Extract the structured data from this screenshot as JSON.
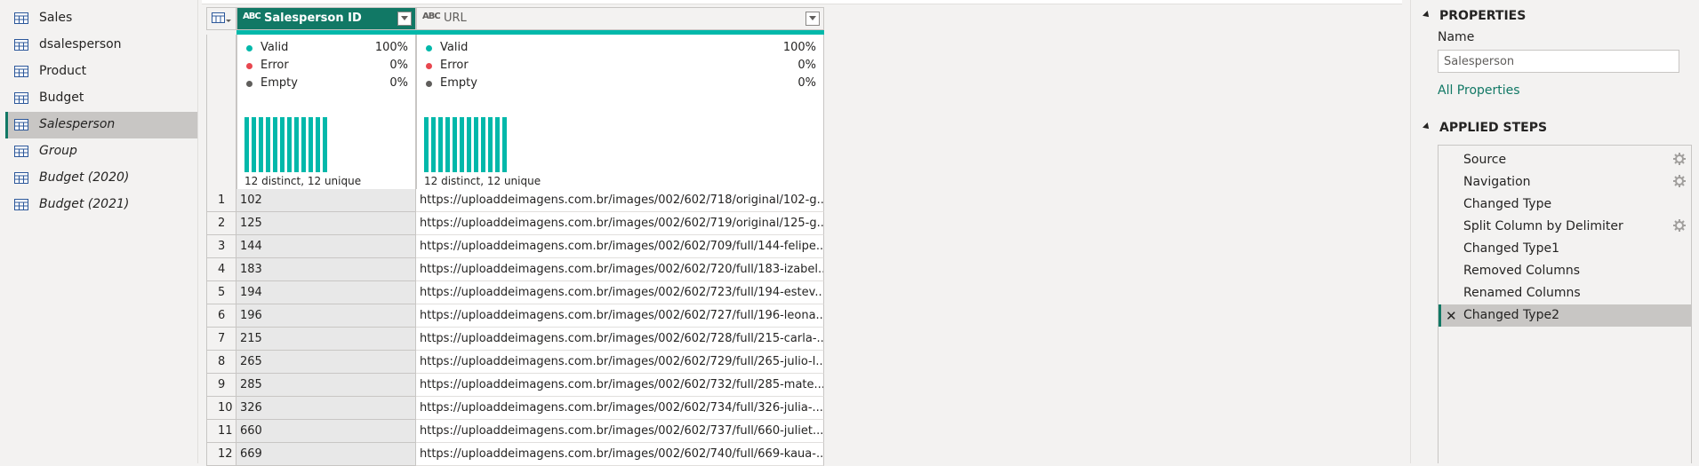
{
  "queries": [
    {
      "label": "Sales",
      "italic": false,
      "selected": false
    },
    {
      "label": "dsalesperson",
      "italic": false,
      "selected": false
    },
    {
      "label": "Product",
      "italic": false,
      "selected": false
    },
    {
      "label": "Budget",
      "italic": false,
      "selected": false
    },
    {
      "label": "Salesperson",
      "italic": true,
      "selected": true
    },
    {
      "label": "Group",
      "italic": true,
      "selected": false
    },
    {
      "label": "Budget (2020)",
      "italic": true,
      "selected": false
    },
    {
      "label": "Budget (2021)",
      "italic": true,
      "selected": false
    }
  ],
  "grid": {
    "type_badge": "ABC",
    "columns": [
      {
        "name": "Salesperson ID",
        "valid_label": "Valid",
        "valid_pct": "100%",
        "error_label": "Error",
        "error_pct": "0%",
        "empty_label": "Empty",
        "empty_pct": "0%",
        "distinct": "12 distinct, 12 unique"
      },
      {
        "name": "URL",
        "valid_label": "Valid",
        "valid_pct": "100%",
        "error_label": "Error",
        "error_pct": "0%",
        "empty_label": "Empty",
        "empty_pct": "0%",
        "distinct": "12 distinct, 12 unique"
      }
    ],
    "rows": [
      {
        "n": "1",
        "id": "102",
        "url": "https://uploaddeimagens.com.br/images/002/602/718/original/102-g..."
      },
      {
        "n": "2",
        "id": "125",
        "url": "https://uploaddeimagens.com.br/images/002/602/719/original/125-g..."
      },
      {
        "n": "3",
        "id": "144",
        "url": "https://uploaddeimagens.com.br/images/002/602/709/full/144-felipe..."
      },
      {
        "n": "4",
        "id": "183",
        "url": "https://uploaddeimagens.com.br/images/002/602/720/full/183-izabel..."
      },
      {
        "n": "5",
        "id": "194",
        "url": "https://uploaddeimagens.com.br/images/002/602/723/full/194-estev..."
      },
      {
        "n": "6",
        "id": "196",
        "url": "https://uploaddeimagens.com.br/images/002/602/727/full/196-leona..."
      },
      {
        "n": "7",
        "id": "215",
        "url": "https://uploaddeimagens.com.br/images/002/602/728/full/215-carla-..."
      },
      {
        "n": "8",
        "id": "265",
        "url": "https://uploaddeimagens.com.br/images/002/602/729/full/265-julio-l..."
      },
      {
        "n": "9",
        "id": "285",
        "url": "https://uploaddeimagens.com.br/images/002/602/732/full/285-mate..."
      },
      {
        "n": "10",
        "id": "326",
        "url": "https://uploaddeimagens.com.br/images/002/602/734/full/326-julia-..."
      },
      {
        "n": "11",
        "id": "660",
        "url": "https://uploaddeimagens.com.br/images/002/602/737/full/660-juliet..."
      },
      {
        "n": "12",
        "id": "669",
        "url": "https://uploaddeimagens.com.br/images/002/602/740/full/669-kaua-..."
      }
    ]
  },
  "properties": {
    "heading": "PROPERTIES",
    "name_label": "Name",
    "name_value": "Salesperson",
    "all_properties": "All Properties"
  },
  "applied_steps": {
    "heading": "APPLIED STEPS",
    "steps": [
      {
        "label": "Source",
        "gear": true,
        "selected": false
      },
      {
        "label": "Navigation",
        "gear": true,
        "selected": false
      },
      {
        "label": "Changed Type",
        "gear": false,
        "selected": false
      },
      {
        "label": "Split Column by Delimiter",
        "gear": true,
        "selected": false
      },
      {
        "label": "Changed Type1",
        "gear": false,
        "selected": false
      },
      {
        "label": "Removed Columns",
        "gear": false,
        "selected": false
      },
      {
        "label": "Renamed Columns",
        "gear": false,
        "selected": false
      },
      {
        "label": "Changed Type2",
        "gear": false,
        "selected": true
      }
    ]
  },
  "colors": {
    "accent": "#117865",
    "quality": "#01b8aa",
    "error_dot": "#e8474f",
    "empty_dot": "#605e5c"
  }
}
